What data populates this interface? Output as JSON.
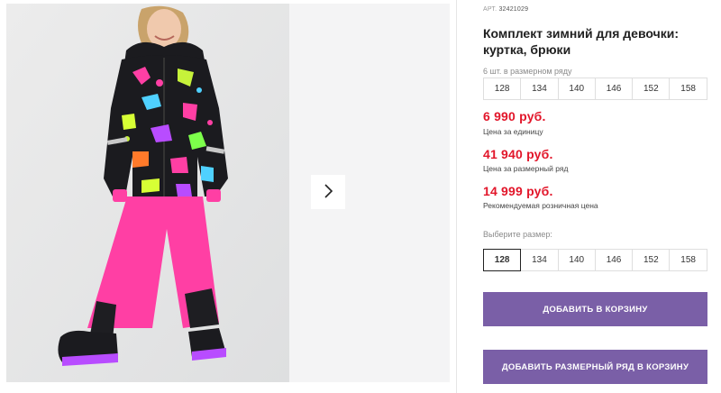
{
  "product": {
    "article_label": "АРТ.",
    "article_value": "32421029",
    "title": "Комплект зимний для девочки: куртка, брюки",
    "row_note": "6 шт. в размерном ряду",
    "row_sizes": [
      "128",
      "134",
      "140",
      "146",
      "152",
      "158"
    ]
  },
  "prices": {
    "unit_price": "6 990 руб.",
    "unit_label": "Цена за единицу",
    "row_price": "41 940 руб.",
    "row_label": "Цена за размерный ряд",
    "retail_price": "14 999 руб.",
    "retail_label": "Рекомендуемая розничная цена"
  },
  "size_selector": {
    "label": "Выберите размер:",
    "options": [
      "128",
      "134",
      "140",
      "146",
      "152",
      "158"
    ],
    "selected": "128"
  },
  "buttons": {
    "add_to_cart": "ДОБАВИТЬ В КОРЗИНУ",
    "add_row_to_cart": "ДОБАВИТЬ РАЗМЕРНЫЙ РЯД В КОРЗИНУ"
  },
  "icons": {
    "next_arrow": "chevron-right-icon"
  },
  "colors": {
    "price_red": "#e2162a",
    "button_purple": "#7a5fa7",
    "jacket_black": "#1b1b1f",
    "pants_pink": "#ff3fa4"
  }
}
